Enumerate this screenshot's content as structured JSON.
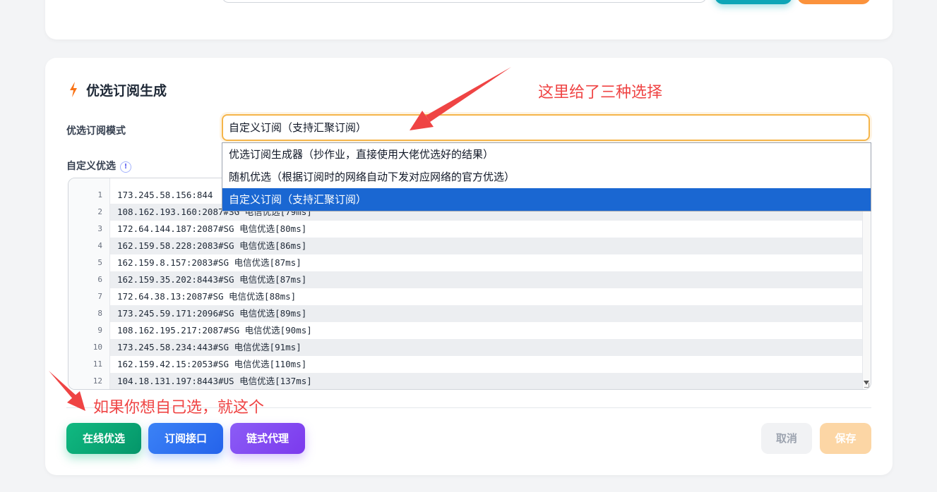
{
  "section": {
    "title": "优选订阅生成"
  },
  "mode": {
    "label": "优选订阅模式",
    "selected": "自定义订阅（支持汇聚订阅）",
    "options": [
      "优选订阅生成器（抄作业，直接使用大佬优选好的结果）",
      "随机优选（根据订阅时的网络自动下发对应网络的官方优选）",
      "自定义订阅（支持汇聚订阅）"
    ]
  },
  "custom": {
    "label": "自定义优选",
    "info_icon": "!",
    "lines": [
      {
        "n": "1",
        "text": "173.245.58.156:844"
      },
      {
        "n": "2",
        "text": "108.162.193.160:2087#SG 电信优选[79ms]"
      },
      {
        "n": "3",
        "text": "172.64.144.187:2087#SG 电信优选[80ms]"
      },
      {
        "n": "4",
        "text": "162.159.58.228:2083#SG 电信优选[86ms]"
      },
      {
        "n": "5",
        "text": "162.159.8.157:2083#SG 电信优选[87ms]"
      },
      {
        "n": "6",
        "text": "162.159.35.202:8443#SG 电信优选[87ms]"
      },
      {
        "n": "7",
        "text": "172.64.38.13:2087#SG 电信优选[88ms]"
      },
      {
        "n": "8",
        "text": "173.245.59.171:2096#SG 电信优选[89ms]"
      },
      {
        "n": "9",
        "text": "108.162.195.217:2087#SG 电信优选[90ms]"
      },
      {
        "n": "10",
        "text": "173.245.58.234:443#SG 电信优选[91ms]"
      },
      {
        "n": "11",
        "text": "162.159.42.15:2053#SG 电信优选[110ms]"
      },
      {
        "n": "12",
        "text": "104.18.131.197:8443#US 电信优选[137ms]"
      }
    ]
  },
  "buttons": {
    "online": "在线优选",
    "api": "订阅接口",
    "chain": "链式代理",
    "cancel": "取消",
    "save": "保存"
  },
  "annotations": {
    "top": "这里给了三种选择",
    "bottom": "如果你想自己选，就这个"
  },
  "colors": {
    "annotation": "#ef4444",
    "selected_option": "#1a67d2",
    "select_border": "#f5b54a"
  }
}
